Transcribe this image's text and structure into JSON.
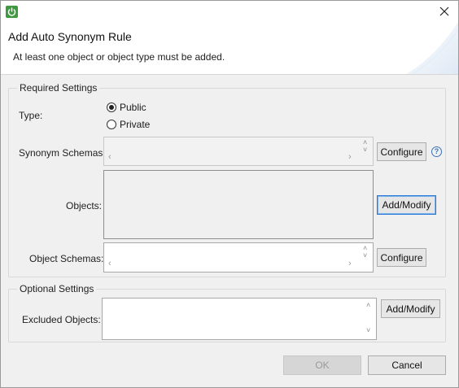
{
  "window": {
    "app_icon": "power-icon",
    "close_glyph": "✕"
  },
  "header": {
    "title": "Add Auto Synonym Rule",
    "message": "At least one object or object type must be added."
  },
  "required_settings": {
    "group_label": "Required Settings",
    "type_label": "Type:",
    "type_options": [
      {
        "label": "Public",
        "selected": true
      },
      {
        "label": "Private",
        "selected": false
      }
    ],
    "synonym_schemas_label": "Synonym Schemas:",
    "synonym_schemas_button": "Configure",
    "objects_label": "Objects:",
    "objects_button": "Add/Modify",
    "object_schemas_label": "Object Schemas:",
    "object_schemas_button": "Configure"
  },
  "optional_settings": {
    "group_label": "Optional Settings",
    "excluded_objects_label": "Excluded Objects:",
    "excluded_objects_button": "Add/Modify"
  },
  "footer": {
    "ok_label": "OK",
    "cancel_label": "Cancel"
  },
  "colors": {
    "accent_green": "#3f9a3f",
    "focus_blue": "#2a7bd8",
    "help_blue": "#3b73b9"
  }
}
